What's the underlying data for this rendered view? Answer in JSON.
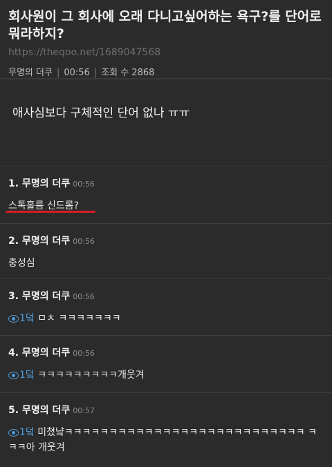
{
  "post": {
    "title": "회사원이 그 회사에 오래 다니고싶어하는 욕구?를 단어로 뭐라하지?",
    "url": "https://theqoo.net/1689047568",
    "author": "무명의 더쿠",
    "time": "00:56",
    "views_label": "조회 수 2868",
    "body": "애사심보다 구체적인 단어 없나 ㅠㅠ"
  },
  "comments": [
    {
      "header": "1. 무명의 더쿠",
      "time": "00:56",
      "text": "스톡홀름 신드롬?"
    },
    {
      "header": "2. 무명의 더쿠",
      "time": "00:56",
      "text": "충성심"
    },
    {
      "header": "3. 무명의 더쿠",
      "time": "00:56",
      "reply": "1덬",
      "text": "ㅁㅊ ㅋㅋㅋㅋㅋㅋㅋ"
    },
    {
      "header": "4. 무명의 더쿠",
      "time": "00:56",
      "reply": "1덬",
      "text": "ㅋㅋㅋㅋㅋㅋㅋㅋㅋ개웃겨"
    },
    {
      "header": "5. 무명의 더쿠",
      "time": "00:57",
      "reply": "1덬",
      "text": "미쳤냨ㅋㅋㅋㅋㅋㅋㅋㅋㅋㅋㅋㅋㅋㅋㅋㅋㅋㅋㅋㅋㅋㅋㅋㅋㅋㅋㅋ ㅋㅋㅋ아 개웃겨"
    }
  ],
  "colors": {
    "accent_red": "#d51e26",
    "reply_blue": "#4f9ad8"
  }
}
